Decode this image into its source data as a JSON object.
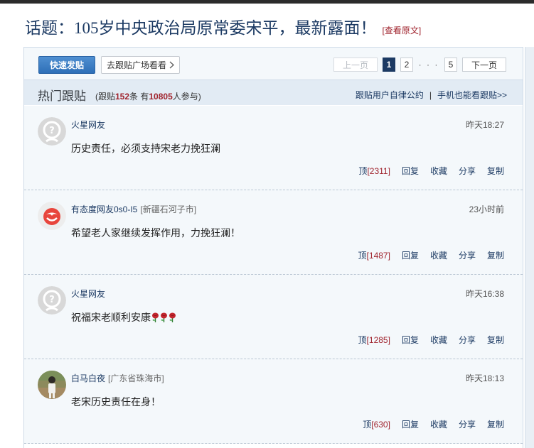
{
  "title": "话题：105岁中央政治局原常委宋平，最新露面！",
  "orig_link": "查看原文",
  "toolbar": {
    "post_button": "快速发贴",
    "plaza_button": "去跟贴广场看看",
    "prev": "上一页",
    "pages": [
      "1",
      "2",
      "5"
    ],
    "dots": "· · ·",
    "next": "下一页"
  },
  "hot": {
    "title": "热门跟贴",
    "stats_prefix": "(跟贴",
    "post_count": "152",
    "stats_mid": "条 有",
    "participant_count": "10805",
    "stats_suffix": "人参与)",
    "link_rules": "跟贴用户自律公约",
    "link_mobile": "手机也能看跟贴>>"
  },
  "comments": [
    {
      "user": "火星网友",
      "location": "",
      "time": "昨天18:27",
      "text": "历史责任，必须支持宋老力挽狂澜",
      "votes": "2311",
      "avatar": "default-avatar-icon"
    },
    {
      "user": "有态度网友0s0-I5",
      "location": "[新疆石河子市]",
      "time": "23小时前",
      "text": "希望老人家继续发挥作用，力挽狂澜！",
      "votes": "1487",
      "avatar": "youtaidu-avatar-icon"
    },
    {
      "user": "火星网友",
      "location": "",
      "time": "昨天16:38",
      "text": "祝福宋老顺利安康",
      "votes": "1285",
      "avatar": "default-avatar-icon",
      "emoji": "rose-icon"
    },
    {
      "user": "白马白夜",
      "location": "[广东省珠海市]",
      "time": "昨天18:13",
      "text": "老宋历史责任在身！",
      "votes": "630",
      "avatar": "photo-avatar"
    }
  ],
  "actions": {
    "top": "顶",
    "reply": "回复",
    "favorite": "收藏",
    "share": "分享",
    "copy": "复制"
  },
  "colors": {
    "accent": "#1c3a63",
    "red": "#a0242e",
    "panel_bg": "#f4f8fb",
    "header_bg": "#e2ebf4"
  }
}
